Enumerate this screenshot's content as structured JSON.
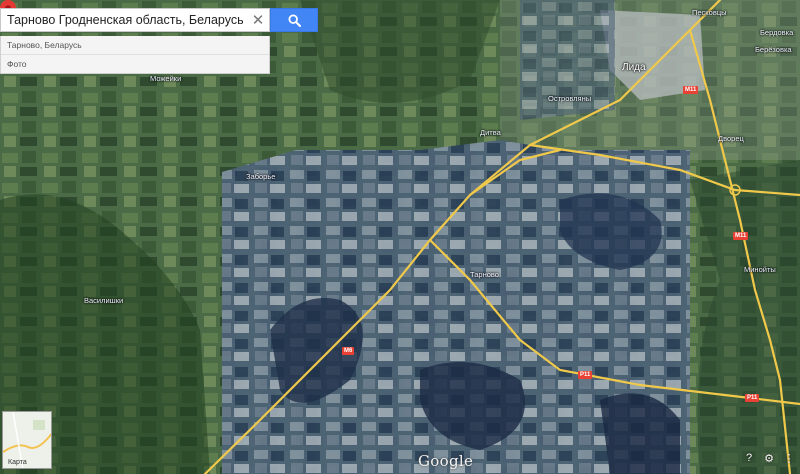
{
  "search": {
    "query": "Тарново Гродненская область, Беларусь",
    "clear_icon": "close-icon",
    "search_icon": "search-icon"
  },
  "suggestions": [
    "Тарново, Беларусь",
    "Фото"
  ],
  "map": {
    "labels": {
      "lida": "Лида",
      "tarnovo": "Тарново",
      "mozhejki": "Можейки",
      "dubrovno": "Дитва",
      "zabrodzha": "Заборье",
      "ostrovlyany": "Островляны",
      "vasilishki": "Василишки",
      "minojty": "Минойты",
      "berdovka": "Бердовка",
      "dvarets": "Дворец",
      "bersko": "Берёзовка",
      "peskovtsy": "Песковцы"
    },
    "roads": {
      "m11": "M11",
      "p11": "P11",
      "m6": "M6",
      "p11b": "P11"
    },
    "colors": {
      "road": "#f0c94a",
      "pin": "#e53935",
      "button": "#4285f4"
    }
  },
  "minimap": {
    "label": "Карта"
  },
  "brand": {
    "logo": "Google"
  },
  "controls": {
    "help_icon": "question-icon",
    "settings_icon": "gear-icon",
    "grid_icon": "apps-icon"
  }
}
